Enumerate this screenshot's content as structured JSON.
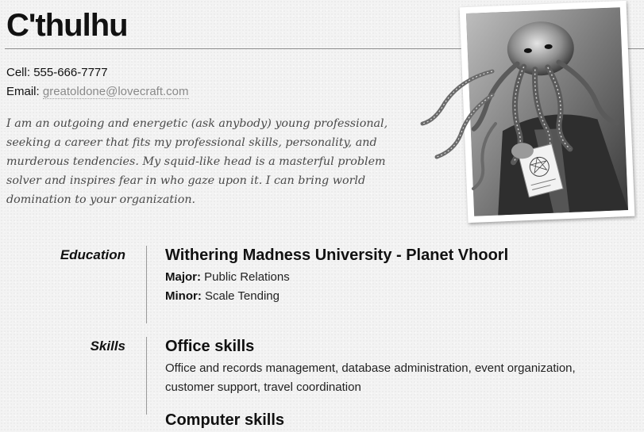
{
  "header": {
    "name": "C'thulhu"
  },
  "contact": {
    "cell_label": "Cell:",
    "cell_value": "555-666-7777",
    "email_label": "Email:",
    "email_value": "greatoldone@lovecraft.com"
  },
  "objective": "I am an outgoing and energetic (ask anybody) young professional, seeking a career that fits my professional skills, personality, and murderous tendencies. My squid-like head is a masterful problem solver and inspires fear in who gaze upon it. I can bring world domination to your organization.",
  "photo": {
    "icon": "cthulhu-portrait",
    "colors": {
      "frame": "#ffffff",
      "tone": "#8a8a8a"
    }
  },
  "education": {
    "label": "Education",
    "school": "Withering Madness University - Planet Vhoorl",
    "major_label": "Major:",
    "major_value": "Public Relations",
    "minor_label": "Minor:",
    "minor_value": "Scale Tending"
  },
  "skills": {
    "label": "Skills",
    "groups": [
      {
        "title": "Office skills",
        "text": "Office and records management, database administration, event organization, customer support, travel coordination"
      },
      {
        "title": "Computer skills"
      }
    ]
  }
}
